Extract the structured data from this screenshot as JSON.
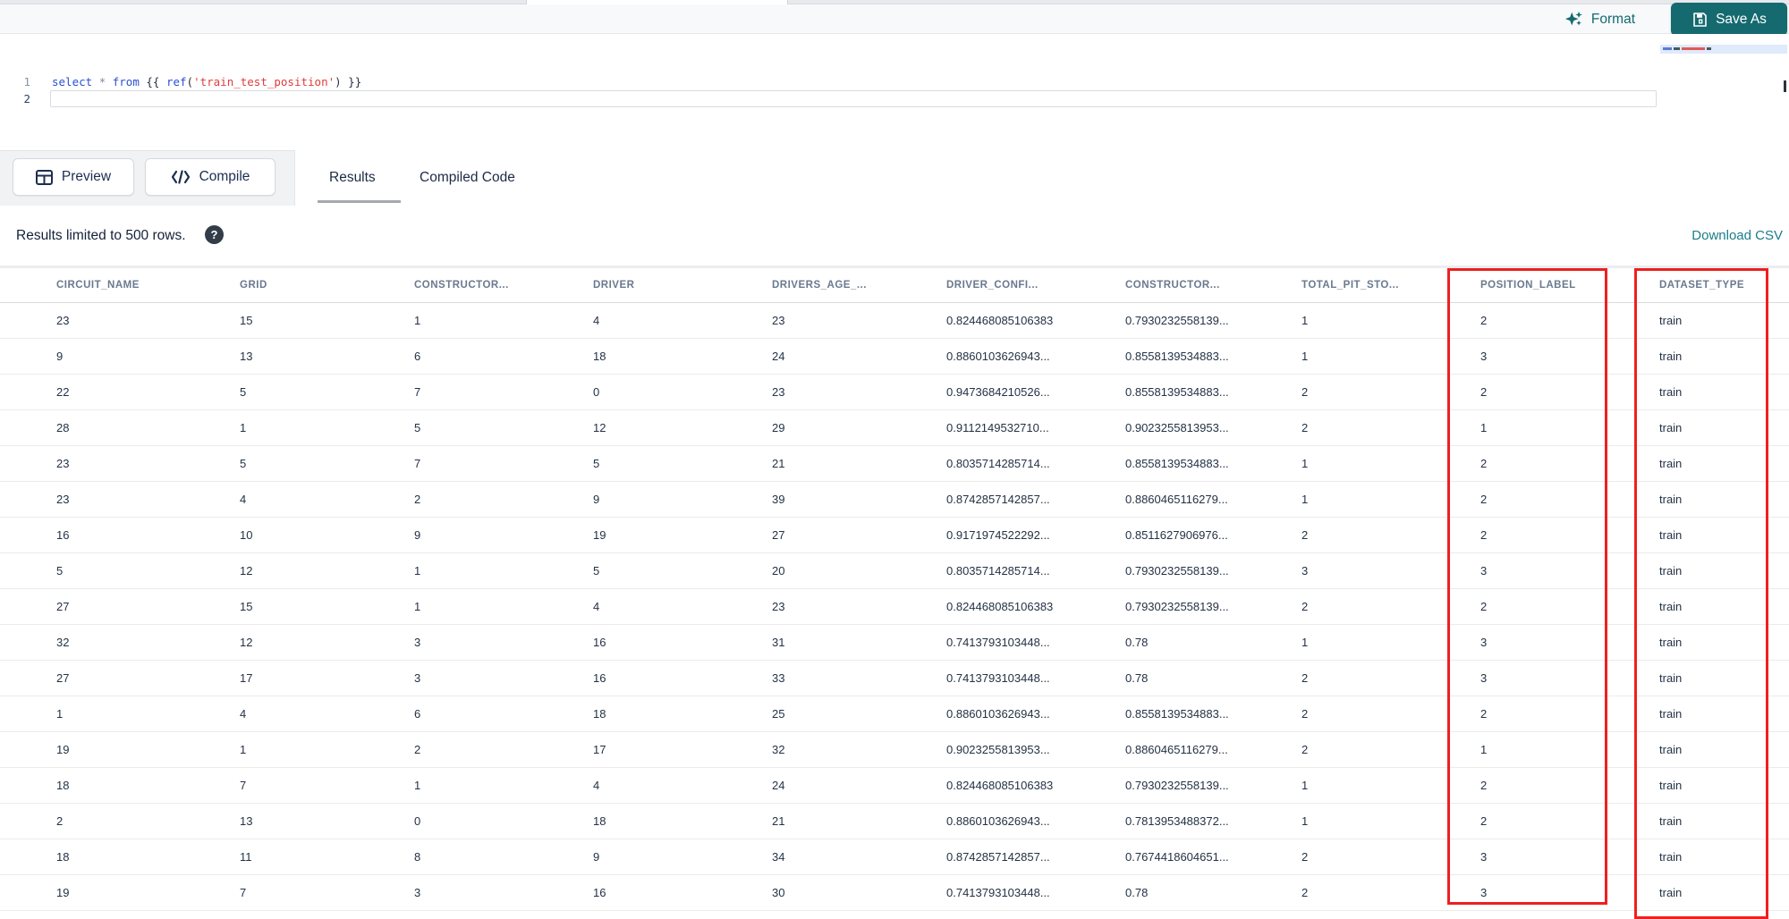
{
  "editor_toolbar": {
    "format_label": "Format",
    "save_as_label": "Save As"
  },
  "editor": {
    "lines": [
      {
        "number": "1",
        "tokens": [
          {
            "text": "select",
            "type": "keyword"
          },
          {
            "text": " ",
            "type": "plain"
          },
          {
            "text": "*",
            "type": "operator"
          },
          {
            "text": " ",
            "type": "plain"
          },
          {
            "text": "from",
            "type": "keyword"
          },
          {
            "text": " {{ ",
            "type": "plain"
          },
          {
            "text": "ref",
            "type": "function"
          },
          {
            "text": "(",
            "type": "plain"
          },
          {
            "text": "'train_test_position'",
            "type": "string"
          },
          {
            "text": ")",
            "type": "plain"
          },
          {
            "text": " }}",
            "type": "plain"
          }
        ]
      },
      {
        "number": "2",
        "tokens": []
      }
    ]
  },
  "action_bar": {
    "preview_label": "Preview",
    "compile_label": "Compile"
  },
  "result_tabs": [
    {
      "label": "Results",
      "active": true
    },
    {
      "label": "Compiled Code",
      "active": false
    }
  ],
  "results_info": {
    "message": "Results limited to 500 rows.",
    "help_glyph": "?",
    "download_label": "Download CSV"
  },
  "table": {
    "columns": [
      "CIRCUIT_NAME",
      "GRID",
      "CONSTRUCTOR...",
      "DRIVER",
      "DRIVERS_AGE_...",
      "DRIVER_CONFI...",
      "CONSTRUCTOR...",
      "TOTAL_PIT_STO...",
      "POSITION_LABEL",
      "DATASET_TYPE"
    ],
    "rows": [
      [
        "23",
        "15",
        "1",
        "4",
        "23",
        "0.824468085106383",
        "0.7930232558139...",
        "1",
        "2",
        "train"
      ],
      [
        "9",
        "13",
        "6",
        "18",
        "24",
        "0.8860103626943...",
        "0.8558139534883...",
        "1",
        "3",
        "train"
      ],
      [
        "22",
        "5",
        "7",
        "0",
        "23",
        "0.9473684210526...",
        "0.8558139534883...",
        "2",
        "2",
        "train"
      ],
      [
        "28",
        "1",
        "5",
        "12",
        "29",
        "0.9112149532710...",
        "0.9023255813953...",
        "2",
        "1",
        "train"
      ],
      [
        "23",
        "5",
        "7",
        "5",
        "21",
        "0.8035714285714...",
        "0.8558139534883...",
        "1",
        "2",
        "train"
      ],
      [
        "23",
        "4",
        "2",
        "9",
        "39",
        "0.8742857142857...",
        "0.8860465116279...",
        "1",
        "2",
        "train"
      ],
      [
        "16",
        "10",
        "9",
        "19",
        "27",
        "0.9171974522292...",
        "0.8511627906976...",
        "2",
        "2",
        "train"
      ],
      [
        "5",
        "12",
        "1",
        "5",
        "20",
        "0.8035714285714...",
        "0.7930232558139...",
        "3",
        "3",
        "train"
      ],
      [
        "27",
        "15",
        "1",
        "4",
        "23",
        "0.824468085106383",
        "0.7930232558139...",
        "2",
        "2",
        "train"
      ],
      [
        "32",
        "12",
        "3",
        "16",
        "31",
        "0.7413793103448...",
        "0.78",
        "1",
        "3",
        "train"
      ],
      [
        "27",
        "17",
        "3",
        "16",
        "33",
        "0.7413793103448...",
        "0.78",
        "2",
        "3",
        "train"
      ],
      [
        "1",
        "4",
        "6",
        "18",
        "25",
        "0.8860103626943...",
        "0.8558139534883...",
        "2",
        "2",
        "train"
      ],
      [
        "19",
        "1",
        "2",
        "17",
        "32",
        "0.9023255813953...",
        "0.8860465116279...",
        "2",
        "1",
        "train"
      ],
      [
        "18",
        "7",
        "1",
        "4",
        "24",
        "0.824468085106383",
        "0.7930232558139...",
        "1",
        "2",
        "train"
      ],
      [
        "2",
        "13",
        "0",
        "18",
        "21",
        "0.8860103626943...",
        "0.7813953488372...",
        "1",
        "2",
        "train"
      ],
      [
        "18",
        "11",
        "8",
        "9",
        "34",
        "0.8742857142857...",
        "0.7674418604651...",
        "2",
        "3",
        "train"
      ],
      [
        "19",
        "7",
        "3",
        "16",
        "30",
        "0.7413793103448...",
        "0.78",
        "2",
        "3",
        "train"
      ]
    ],
    "highlighted_columns": [
      "POSITION_LABEL",
      "DATASET_TYPE"
    ]
  },
  "colors": {
    "accent_teal": "#156a70",
    "link_teal": "#1b7d89",
    "highlight_red": "#ef1f1f",
    "keyword_blue": "#2b50d0",
    "string_red": "#e23b3b"
  }
}
